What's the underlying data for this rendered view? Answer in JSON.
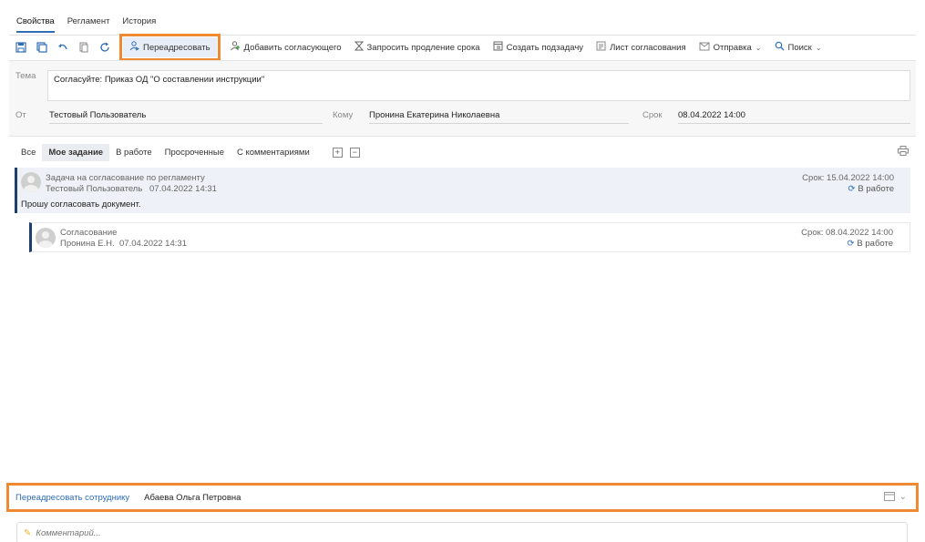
{
  "tabs": [
    "Свойства",
    "Регламент",
    "История"
  ],
  "toolbar": {
    "forward_label": "Переадресовать",
    "add_approver_label": "Добавить согласующего",
    "request_extension_label": "Запросить продление срока",
    "create_subtask_label": "Создать подзадачу",
    "approval_sheet_label": "Лист согласования",
    "send_label": "Отправка",
    "search_label": "Поиск",
    "icons": [
      "save-icon",
      "save-close-icon",
      "undo-icon",
      "copy-icon",
      "refresh-icon"
    ]
  },
  "form": {
    "subject_label": "Тема",
    "subject_value": "Согласуйте: Приказ ОД \"О составлении инструкции\"",
    "from_label": "От",
    "from_value": "Тестовый Пользователь",
    "to_label": "Кому",
    "to_value": "Пронина Екатерина Николаевна",
    "due_label": "Срок",
    "due_value": "08.04.2022 14:00"
  },
  "filters": [
    "Все",
    "Мое задание",
    "В работе",
    "Просроченные",
    "С комментариями"
  ],
  "filters_active": "Мое задание",
  "tasks": [
    {
      "title": "Задача на согласование по регламенту",
      "author": "Тестовый Пользователь",
      "date": "07.04.2022 14:31",
      "due": "Срок: 15.04.2022 14:00",
      "status": "В работе",
      "message": "Прошу согласовать документ."
    },
    {
      "title": "Согласование",
      "author": "Пронина Е.Н.",
      "date": "07.04.2022 14:31",
      "due": "Срок: 08.04.2022 14:00",
      "status": "В работе"
    }
  ],
  "forward": {
    "link_label": "Переадресовать сотруднику",
    "input_value": "Абаева Ольга Петровна"
  },
  "comment": {
    "placeholder": "Комментарий..."
  },
  "colors": {
    "accent": "#2f6db5",
    "highlight": "#ef8a33",
    "task_bar": "#1d3f6e"
  }
}
